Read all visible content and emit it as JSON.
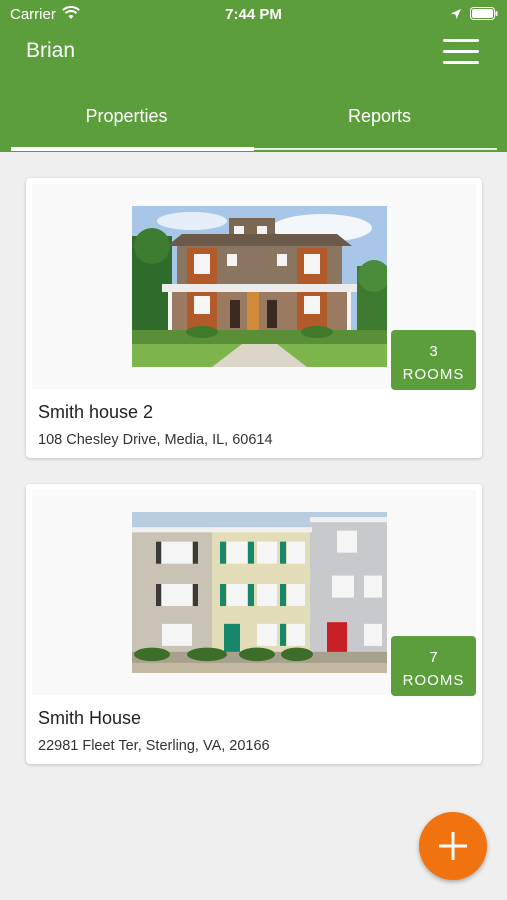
{
  "status_bar": {
    "carrier": "Carrier",
    "time": "7:44 PM"
  },
  "app_bar": {
    "title": "Brian",
    "menu_icon": "hamburger-menu-icon"
  },
  "tabs": [
    {
      "label": "Properties",
      "selected": true
    },
    {
      "label": "Reports",
      "selected": false
    }
  ],
  "properties": [
    {
      "name": "Smith house 2",
      "address": "108 Chesley Drive, Media, IL, 60614",
      "rooms_count": "3",
      "rooms_label": "ROOMS"
    },
    {
      "name": "Smith House",
      "address": "22981 Fleet Ter, Sterling, VA, 20166",
      "rooms_count": "7",
      "rooms_label": "ROOMS"
    }
  ],
  "fab": {
    "icon": "plus-icon"
  },
  "colors": {
    "primary": "#5c9e3c",
    "fab": "#f0730f",
    "background": "#efefef"
  }
}
